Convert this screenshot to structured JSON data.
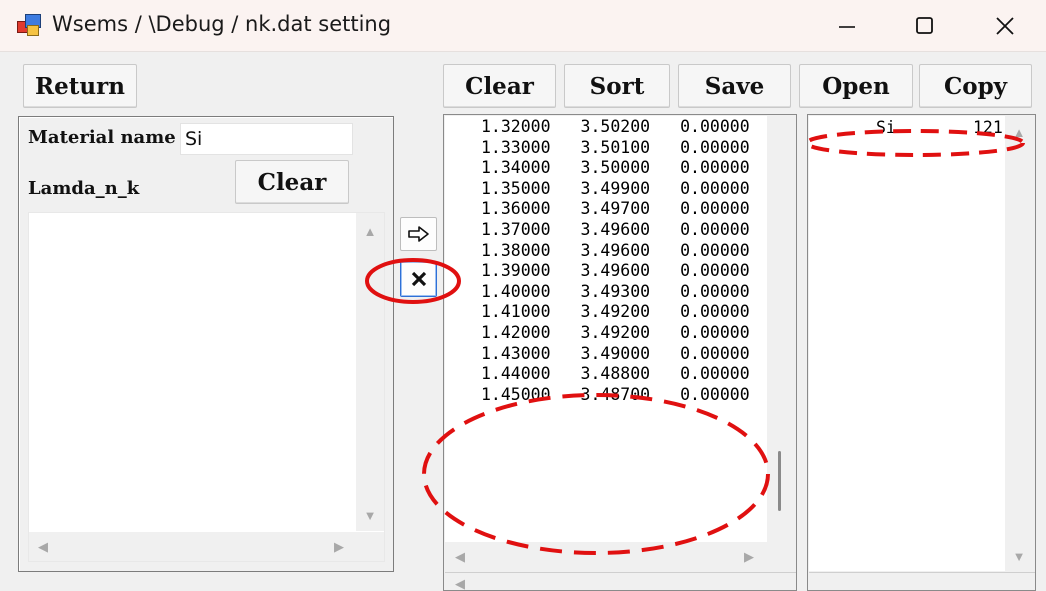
{
  "window": {
    "title": "Wsems / \\Debug / nk.dat setting",
    "controls": [
      "minimize",
      "maximize",
      "close"
    ]
  },
  "toolbar": {
    "return_label": "Return",
    "clear_label": "Clear",
    "sort_label": "Sort",
    "save_label": "Save",
    "open_label": "Open",
    "copy_label": "Copy"
  },
  "material": {
    "name_label": "Material name",
    "name_value": "Si",
    "lamda_label": "Lamda_n_k",
    "clear_label": "Clear"
  },
  "middle": {
    "add_icon": "arrow-right-icon",
    "delete_icon": "close-x-icon"
  },
  "nk_table": {
    "rows": [
      [
        "1.32000",
        "3.50200",
        "0.00000"
      ],
      [
        "1.33000",
        "3.50100",
        "0.00000"
      ],
      [
        "1.34000",
        "3.50000",
        "0.00000"
      ],
      [
        "1.35000",
        "3.49900",
        "0.00000"
      ],
      [
        "1.36000",
        "3.49700",
        "0.00000"
      ],
      [
        "1.37000",
        "3.49600",
        "0.00000"
      ],
      [
        "1.38000",
        "3.49600",
        "0.00000"
      ],
      [
        "1.39000",
        "3.49600",
        "0.00000"
      ],
      [
        "1.40000",
        "3.49300",
        "0.00000"
      ],
      [
        "1.41000",
        "3.49200",
        "0.00000"
      ],
      [
        "1.42000",
        "3.49200",
        "0.00000"
      ],
      [
        "1.43000",
        "3.49000",
        "0.00000"
      ],
      [
        "1.44000",
        "3.48800",
        "0.00000"
      ],
      [
        "1.45000",
        "3.48700",
        "0.00000"
      ]
    ]
  },
  "materials_list": {
    "items": [
      {
        "name": "Si",
        "count": "121"
      }
    ]
  },
  "annotations": {
    "color": "#e01010"
  }
}
